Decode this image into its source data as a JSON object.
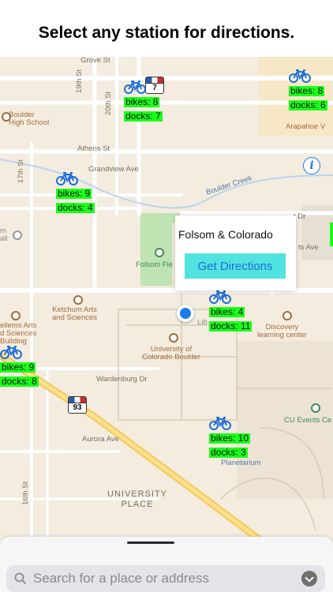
{
  "heading": {
    "text": "Select any station for directions."
  },
  "map": {
    "street_labels": {
      "grove_st": "Grove St",
      "nineteenth_st": "19th St",
      "twentieth_st": "20th St",
      "athens_st": "Athens St",
      "seventeenth_st": "17th St",
      "grandview_ave": "Grandview Ave",
      "boulder_creek": "Boulder Creek",
      "wardenbourg_dr": "Wardenburg Dr",
      "aurora_ave": "Aurora Ave",
      "sixteenth_st": "16th St",
      "ts_ave": "ts Ave",
      "t_dr": "t Dr"
    },
    "place_labels": {
      "boulder_high_school": "Boulder\nHigh School",
      "arapahoe": "Arapahoe V",
      "folsom_field": "Folsom Fie",
      "ketchum": "Ketchum Arts\nand Sciences",
      "ellems": "ellems Arts\nd Sciences\nBuilding",
      "university": "University of\nColorado Boulder",
      "discovery": "Discovery\nlearning center",
      "cu_events": "CU Events Ce",
      "planetarium": "Planetarium",
      "university_place": "UNIVERSITY\nPLACE",
      "lib": "Lib",
      "am_all": "m\nall"
    },
    "highway_shields": {
      "a": "7",
      "b": "93"
    },
    "stations": [
      {
        "bikes": "bikes: 8",
        "docks": "docks: 7"
      },
      {
        "bikes": "bikes: 8",
        "docks": "docks: 6"
      },
      {
        "bikes": "bikes: 9",
        "docks": "docks: 4"
      },
      {
        "bikes": "bikes: 4",
        "docks": "docks: 11"
      },
      {
        "bikes": "bikes: 9",
        "docks": "docks: 8"
      },
      {
        "bikes": "bikes: 10",
        "docks": "docks: 3"
      }
    ],
    "callout": {
      "title": "Folsom & Colorado",
      "button": "Get Directions"
    },
    "colors": {
      "station_tag": "#19ff19",
      "get_directions_bg": "#52e3e0",
      "get_directions_text": "#1d6ddb",
      "user_location": "#1b7cf0"
    }
  },
  "search": {
    "placeholder": "Search for a place or address"
  }
}
